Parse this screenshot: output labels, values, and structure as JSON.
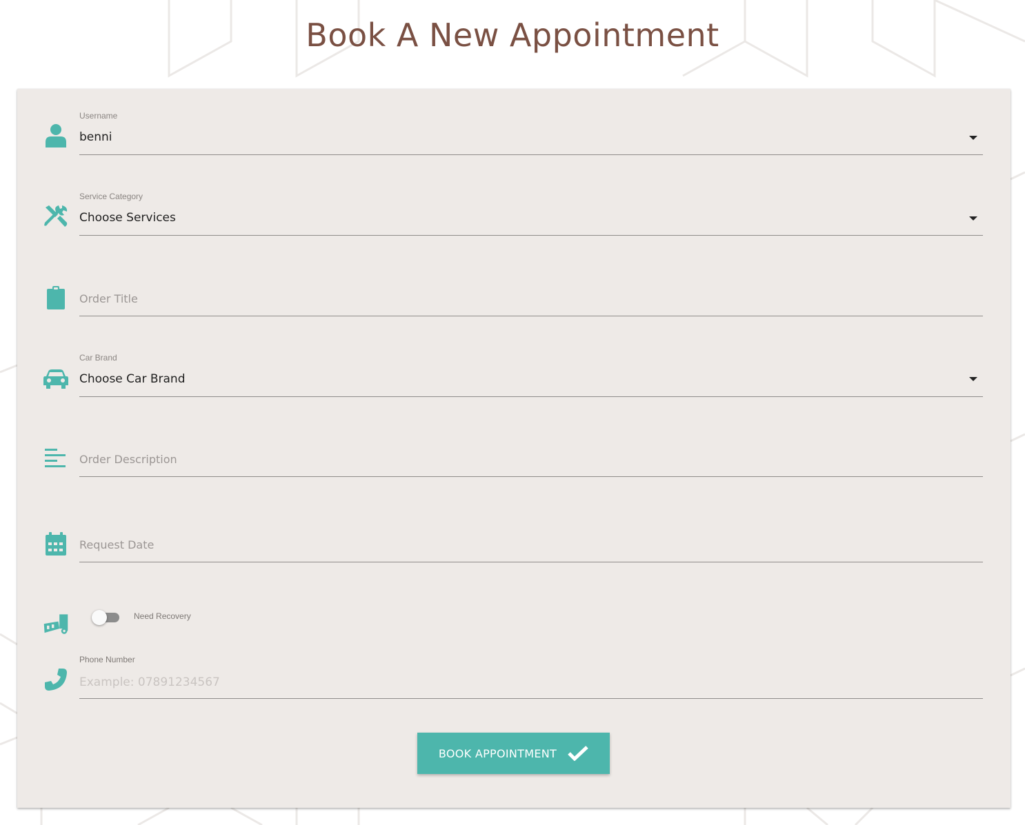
{
  "title": "Book A New Appointment",
  "colors": {
    "accent": "#4db6ac",
    "title": "#7a5043",
    "card_bg": "#eeeae7"
  },
  "form": {
    "username": {
      "label": "Username",
      "value": "benni",
      "icon": "person-icon"
    },
    "service_category": {
      "label": "Service Category",
      "value": "Choose Services",
      "icon": "tools-icon"
    },
    "order_title": {
      "placeholder": "Order Title",
      "icon": "clipboard-icon"
    },
    "car_brand": {
      "label": "Car Brand",
      "value": "Choose Car Brand",
      "icon": "car-icon"
    },
    "order_description": {
      "placeholder": "Order Description",
      "icon": "align-left-icon"
    },
    "request_date": {
      "placeholder": "Request Date",
      "icon": "calendar-icon"
    },
    "need_recovery": {
      "label": "Need Recovery",
      "checked": false,
      "icon": "tow-truck-icon"
    },
    "phone_number": {
      "label": "Phone Number",
      "placeholder": "Example: 07891234567",
      "icon": "phone-icon"
    }
  },
  "submit": {
    "label": "BOOK APPOINTMENT",
    "icon": "check-icon"
  }
}
